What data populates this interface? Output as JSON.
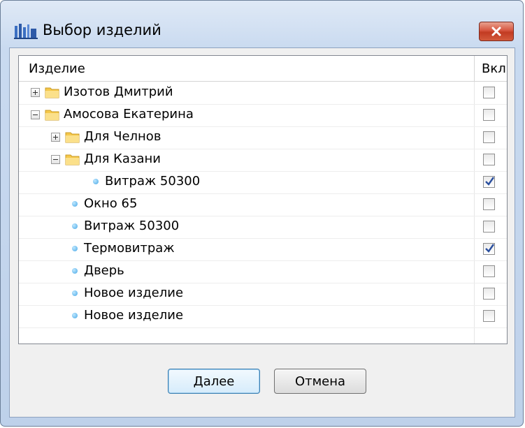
{
  "window": {
    "title": "Выбор изделий"
  },
  "tree": {
    "columns": {
      "name": "Изделие",
      "enabled": "Вкл"
    },
    "rows": [
      {
        "label": "Изотов Дмитрий",
        "kind": "folder",
        "expander": "collapsed",
        "checked": false
      },
      {
        "label": "Амосова Екатерина",
        "kind": "folder",
        "expander": "expanded",
        "checked": false
      },
      {
        "label": "Для Челнов",
        "kind": "folder",
        "expander": "collapsed",
        "checked": false
      },
      {
        "label": "Для Казани",
        "kind": "folder",
        "expander": "expanded",
        "checked": false
      },
      {
        "label": "Витраж 50300",
        "kind": "item",
        "checked": true
      },
      {
        "label": "Окно 65",
        "kind": "item",
        "checked": false
      },
      {
        "label": "Витраж 50300",
        "kind": "item",
        "checked": false
      },
      {
        "label": "Термовитраж",
        "kind": "item",
        "checked": true
      },
      {
        "label": "Дверь",
        "kind": "item",
        "checked": false
      },
      {
        "label": "Новое изделие",
        "kind": "item",
        "checked": false
      },
      {
        "label": "Новое изделие",
        "kind": "item",
        "checked": false
      }
    ]
  },
  "buttons": {
    "next": "Далее",
    "cancel": "Отмена"
  },
  "icons": {
    "app": "app-logo-icon",
    "close": "close-icon",
    "folder": "folder-icon",
    "item": "bullet-icon",
    "check": "checkmark-icon"
  },
  "colors": {
    "close_button": "#c23b22",
    "bullet": "#47a7e6",
    "folder": "#f5c84a",
    "check": "#2a4f9e"
  }
}
